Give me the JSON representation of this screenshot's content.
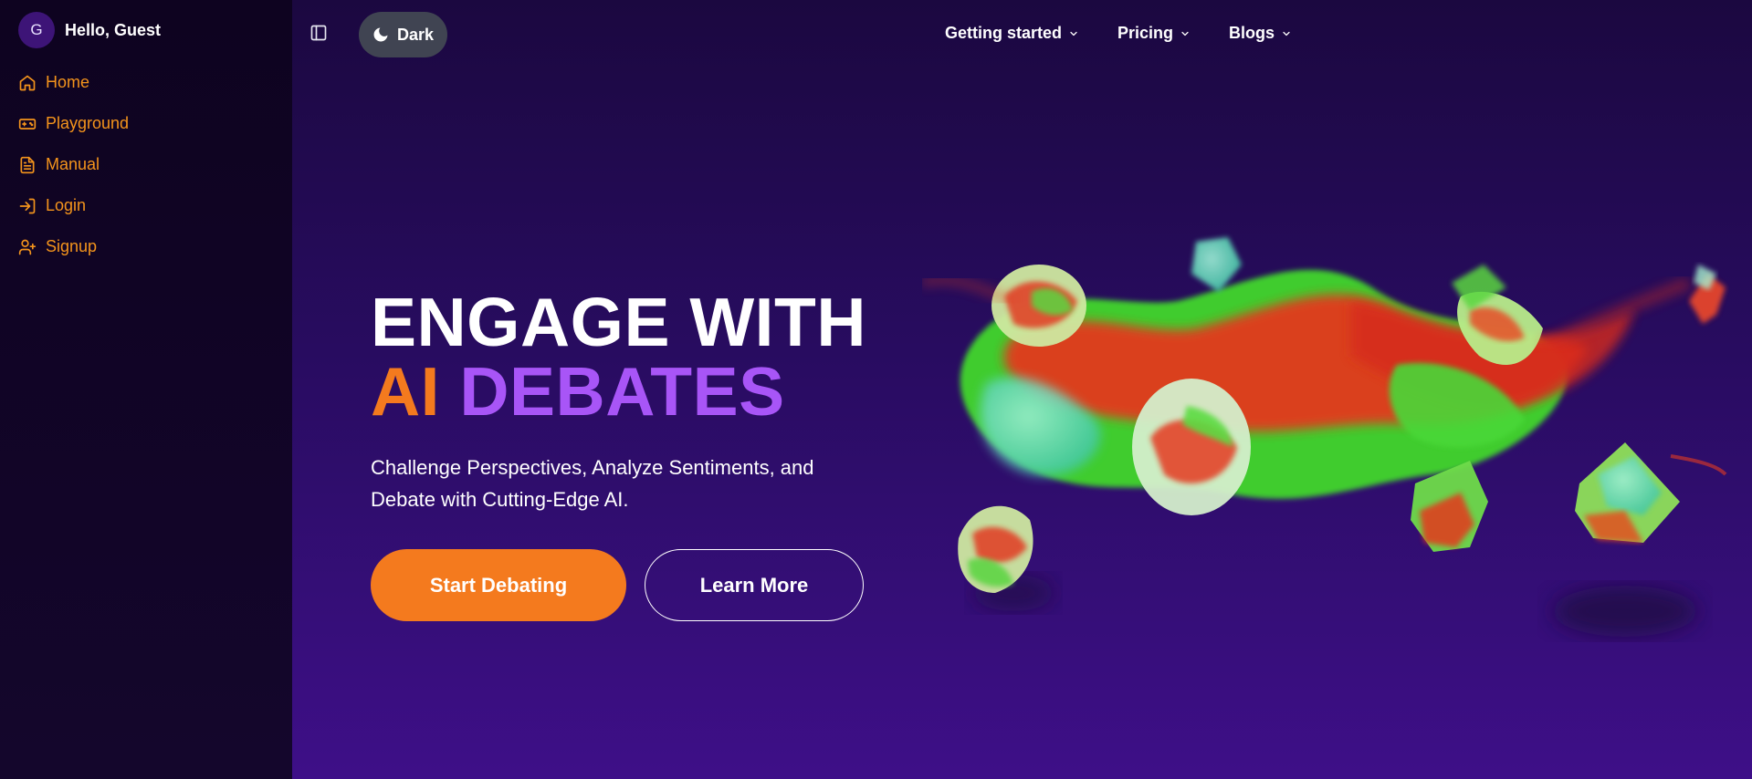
{
  "sidebar": {
    "avatar_letter": "G",
    "greeting": "Hello, Guest",
    "items": [
      {
        "label": "Home",
        "icon": "home-icon"
      },
      {
        "label": "Playground",
        "icon": "gamepad-icon"
      },
      {
        "label": "Manual",
        "icon": "document-icon"
      },
      {
        "label": "Login",
        "icon": "login-icon"
      },
      {
        "label": "Signup",
        "icon": "user-plus-icon"
      }
    ]
  },
  "header": {
    "theme_label": "Dark",
    "nav": [
      {
        "label": "Getting started"
      },
      {
        "label": "Pricing"
      },
      {
        "label": "Blogs"
      }
    ]
  },
  "hero": {
    "headline_line1": "ENGAGE WITH",
    "headline_ai": "AI",
    "headline_debates": "DEBATES",
    "subtitle": "Challenge Perspectives, Analyze Sentiments, and Debate with Cutting-Edge AI.",
    "primary_button": "Start Debating",
    "secondary_button": "Learn More"
  },
  "colors": {
    "accent_orange": "#f47a1e",
    "accent_purple": "#a855f7",
    "sidebar_link": "#f4941c",
    "background": "#280c60"
  }
}
